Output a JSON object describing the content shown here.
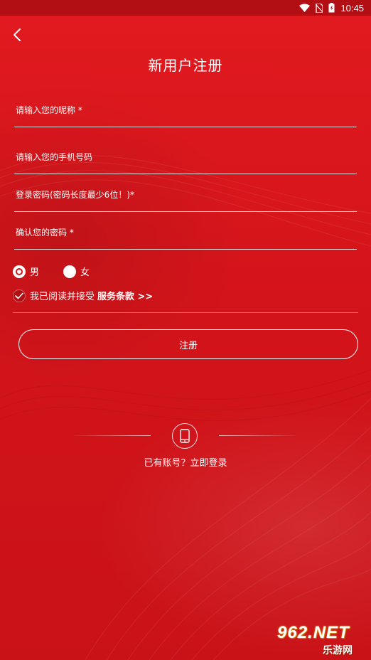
{
  "status_bar": {
    "time": "10:45",
    "icons": [
      "wifi-icon",
      "no-sim-icon",
      "battery-icon"
    ]
  },
  "header": {
    "title": "新用户注册",
    "back_icon": "chevron-left-icon"
  },
  "form": {
    "nickname_placeholder": "请输入您的昵称 *",
    "phone_placeholder": "请输入您的手机号码",
    "password_placeholder": "登录密码(密码长度最少6位！)*",
    "confirm_placeholder": "确认您的密码 *",
    "gender": {
      "options": [
        "男",
        "女"
      ],
      "selected": "男"
    },
    "agree": {
      "checked": true,
      "text": "我已阅读并接受",
      "link_label": "服务条款 >>"
    },
    "register_label": "注册"
  },
  "login_section": {
    "icon": "phone-icon",
    "text": "已有账号？立即登录"
  },
  "watermark": {
    "top": "962.NET",
    "bottom": "乐游网"
  },
  "colors": {
    "background": "#d5141a",
    "status_bar": "#b20f14",
    "text": "#ffffff"
  }
}
